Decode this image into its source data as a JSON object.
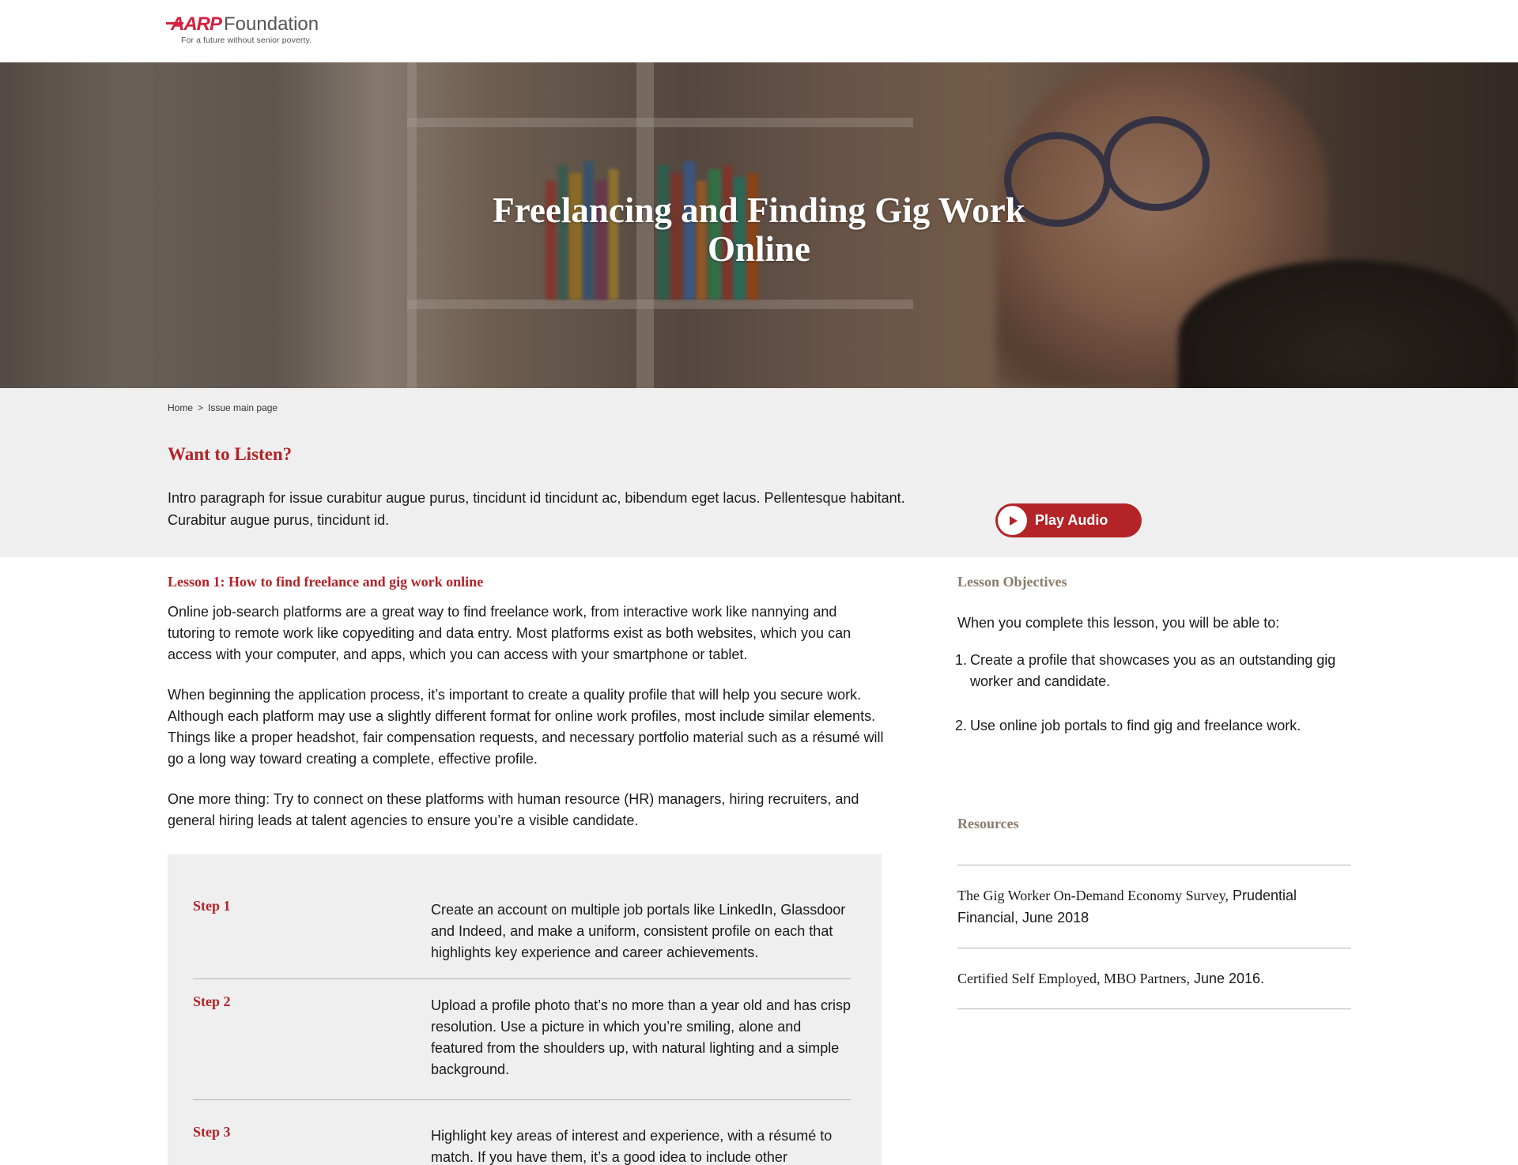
{
  "header": {
    "logo_brand": "AARP",
    "logo_name": "Foundation",
    "logo_tagline": "For a future without senior poverty."
  },
  "hero": {
    "title": "Freelancing and Finding Gig Work Online"
  },
  "breadcrumb": {
    "home": "Home",
    "separator": ">",
    "current": "Issue main page"
  },
  "listen": {
    "title": "Want to Listen?",
    "intro": "Intro paragraph for issue curabitur augue purus, tincidunt id tincidunt ac, bibendum eget lacus. Pellentesque habitant. Curabitur augue purus, tincidunt id.",
    "play_label": "Play Audio"
  },
  "lesson": {
    "title": "Lesson 1: How to find freelance and gig work online",
    "paragraphs": [
      "Online job-search platforms are a great way to find freelance work, from interactive work like nannying and tutoring to remote work like copyediting and data entry. Most platforms exist as both websites, which you can access with your computer, and apps, which you can access with your smartphone or tablet.",
      "When beginning the application process, it’s important to create a quality profile that will help you secure work. Although each platform may use a slightly different format for online work profiles, most include similar elements. Things like a proper headshot, fair compensation requests, and necessary portfolio material such as a résumé will go a long way toward creating a complete, effective profile.",
      "One more thing: Try to connect on these platforms with human resource (HR) managers, hiring recruiters, and general hiring leads at talent agencies to ensure you’re a visible candidate."
    ],
    "steps": [
      {
        "label": "Step 1",
        "text": "Create an account on multiple job portals like LinkedIn, Glassdoor and Indeed, and make a uniform, consistent profile on each that highlights key experience and career achievements."
      },
      {
        "label": "Step 2",
        "text": "Upload a profile photo that’s no more than a year old and has crisp resolution. Use a picture in which you’re smiling, alone and featured from the shoulders up, with natural lighting and a simple background."
      },
      {
        "label": "Step 3",
        "text": "Highlight key areas of interest and experience, with a résumé to match. If you have them, it’s a good idea to include other"
      }
    ]
  },
  "sidebar": {
    "objectives_heading": "Lesson Objectives",
    "objectives_intro": "When you complete this lesson, you will be able to:",
    "objectives": [
      {
        "num": "1.",
        "text": "Create a profile that showcases you as an outstanding gig worker and candidate."
      },
      {
        "num": "2.",
        "text": "Use online job portals to find gig and freelance work."
      }
    ],
    "resources_heading": "Resources",
    "resources": [
      {
        "source": "The Gig Worker On-Demand Economy Survey,",
        "detail": " Prudential Financial, June 2018"
      },
      {
        "source": "Certified Self Employed, MBO Partners,",
        "detail": " June 2016."
      }
    ]
  },
  "colors": {
    "brand_red": "#b42328",
    "logo_red": "#d4213d",
    "band_gray": "#efefef",
    "sidebar_heading": "#8a7a6a"
  }
}
